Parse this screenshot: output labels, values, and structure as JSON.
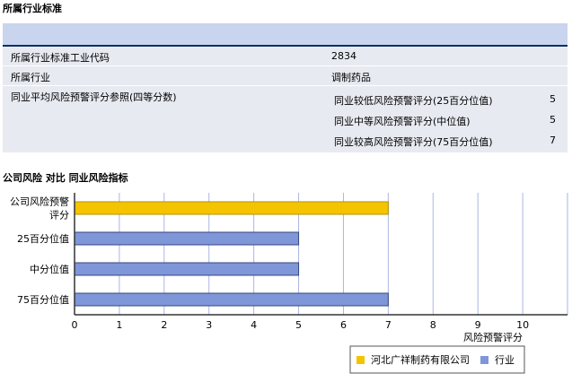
{
  "section1": {
    "title": "所属行业标准"
  },
  "table": {
    "rows": [
      {
        "label": "所属行业标准工业代码",
        "value": "2834"
      },
      {
        "label": "所属行业",
        "value": "调制药品"
      }
    ],
    "avg_label": "同业平均风险预警评分参照(四等分数)",
    "avg_items": [
      {
        "label": "同业较低风险预警评分(25百分位值)",
        "value": "5"
      },
      {
        "label": "同业中等风险预警评分(中位值)",
        "value": "5"
      },
      {
        "label": "同业较高风险预警评分(75百分位值)",
        "value": "7"
      }
    ]
  },
  "section2": {
    "title": "公司风险 对比 同业风险指标"
  },
  "chart_data": {
    "type": "bar",
    "orientation": "horizontal",
    "categories": [
      "公司风险预警评分",
      "25百分位值",
      "中分位值",
      "75百分位值"
    ],
    "category_lines": [
      [
        "公司风险预警",
        "评分"
      ],
      [
        "25百分位值"
      ],
      [
        "中分位值"
      ],
      [
        "75百分位值"
      ]
    ],
    "series": [
      {
        "name": "河北广祥制药有限公司",
        "color": "#f5c400",
        "values": [
          7,
          null,
          null,
          null
        ]
      },
      {
        "name": "行业",
        "color": "#7f96d9",
        "values": [
          null,
          5,
          5,
          7
        ]
      }
    ],
    "xlabel": "风险预警评分",
    "xlim": [
      0,
      11
    ],
    "xticks": [
      0,
      1,
      2,
      3,
      4,
      5,
      6,
      7,
      8,
      9,
      10
    ],
    "grid": true,
    "legend_position": "bottom-right"
  }
}
